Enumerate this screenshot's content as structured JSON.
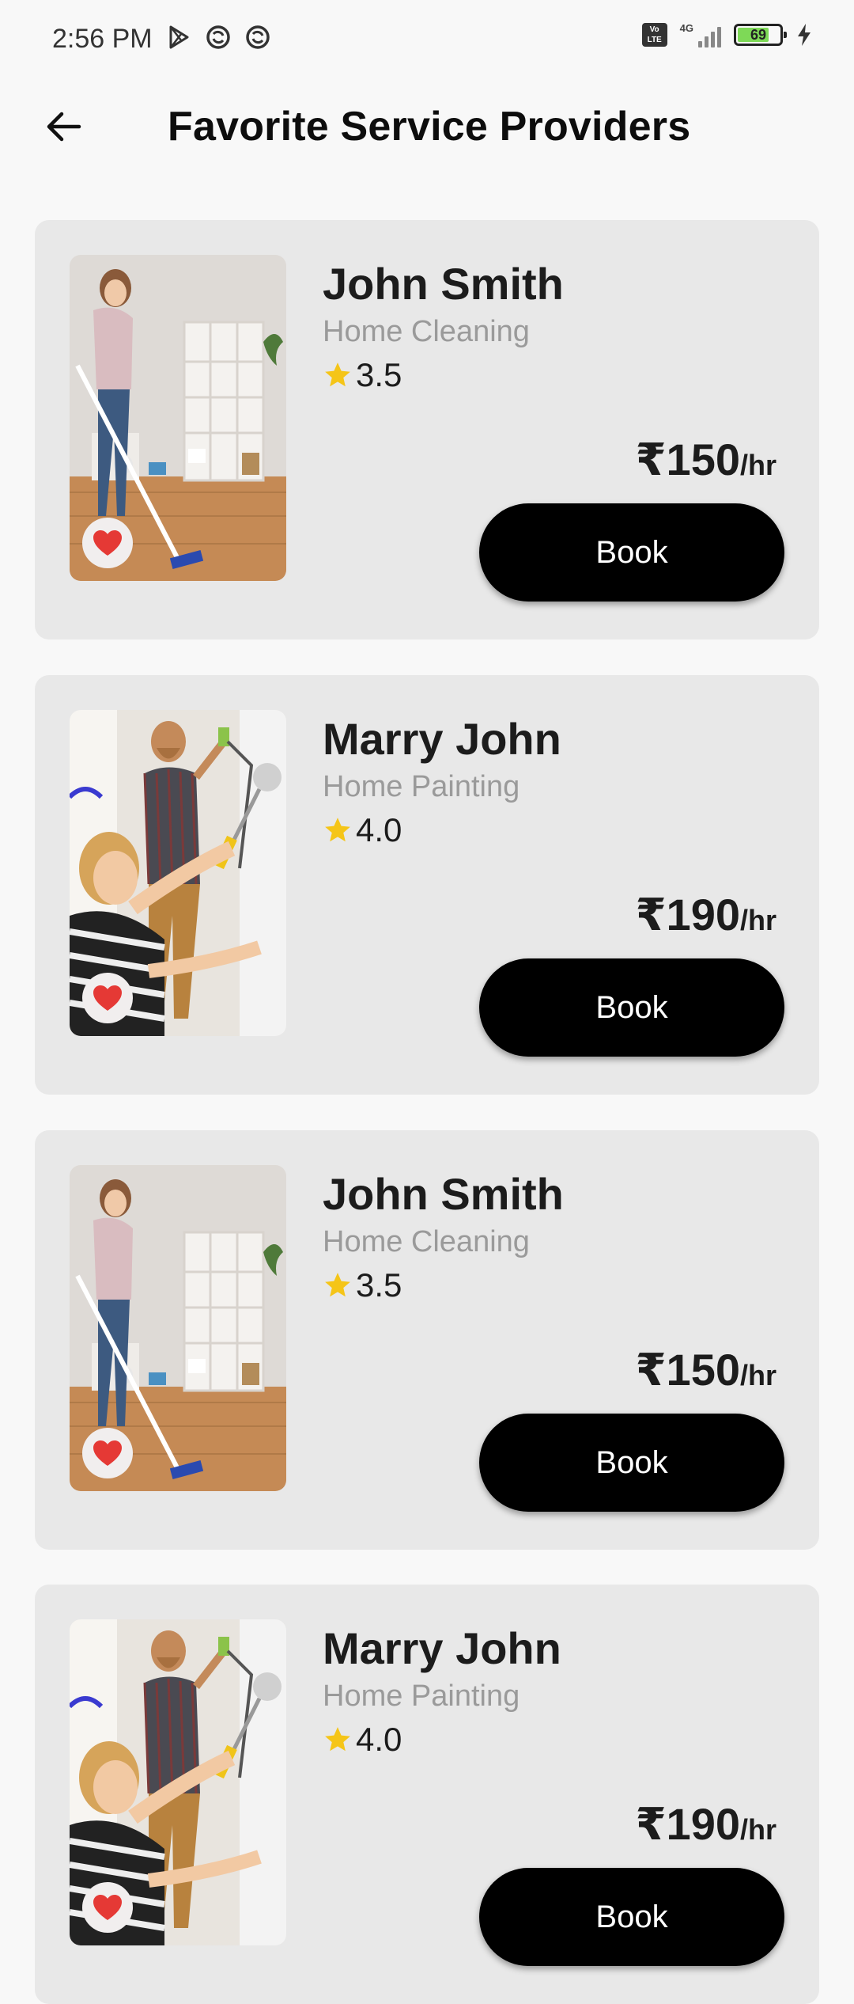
{
  "status_bar": {
    "time": "2:56 PM",
    "battery_level": "69",
    "network": "4G",
    "volte": "Vo LTE"
  },
  "header": {
    "title": "Favorite Service Providers"
  },
  "providers": [
    {
      "name": "John Smith",
      "service": "Home Cleaning",
      "rating": "3.5",
      "price": "₹150",
      "unit": "/hr",
      "book_label": "Book",
      "image": "cleaning-photo"
    },
    {
      "name": "Marry John",
      "service": "Home Painting",
      "rating": "4.0",
      "price": "₹190",
      "unit": "/hr",
      "book_label": "Book",
      "image": "painting-photo"
    },
    {
      "name": "John Smith",
      "service": "Home Cleaning",
      "rating": "3.5",
      "price": "₹150",
      "unit": "/hr",
      "book_label": "Book",
      "image": "cleaning-photo"
    },
    {
      "name": "Marry John",
      "service": "Home Painting",
      "rating": "4.0",
      "price": "₹190",
      "unit": "/hr",
      "book_label": "Book",
      "image": "painting-photo"
    }
  ],
  "colors": {
    "background": "#f8f8f8",
    "card": "#e8e8e8",
    "button": "#000000",
    "heart": "#e53935",
    "star": "#f5c518",
    "muted_text": "#9a9a9a"
  },
  "icons": {
    "back": "arrow-left-icon",
    "favorite": "heart-icon",
    "rating": "star-icon"
  }
}
